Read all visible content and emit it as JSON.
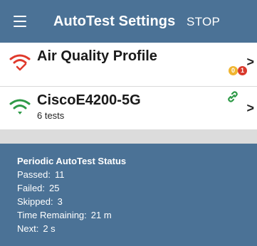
{
  "app_bar": {
    "menu_icon": "hamburger-menu-icon",
    "title": "AutoTest Settings",
    "stop_label": "STOP"
  },
  "profiles": [
    {
      "name": "Air Quality Profile",
      "icon": "wifi-error-icon",
      "icon_color": "#e03a2c",
      "badge_warning": "0",
      "badge_error": "1",
      "chevron": ">"
    },
    {
      "name": "CiscoE4200-5G",
      "subtitle": "6 tests",
      "icon": "wifi-connected-icon",
      "icon_color": "#2e9a47",
      "link_icon": "link-icon",
      "chevron": ">"
    }
  ],
  "status": {
    "heading": "Periodic AutoTest Status",
    "passed_label": "Passed:",
    "passed_value": "11",
    "failed_label": "Failed:",
    "failed_value": "25",
    "skipped_label": "Skipped:",
    "skipped_value": "3",
    "time_remaining_label": "Time Remaining:",
    "time_remaining_value": "21 m",
    "next_label": "Next:",
    "next_value": "2 s"
  },
  "colors": {
    "primary": "#4b7296",
    "error": "#d9392c",
    "warning": "#f0b530",
    "success": "#2e9a47"
  }
}
